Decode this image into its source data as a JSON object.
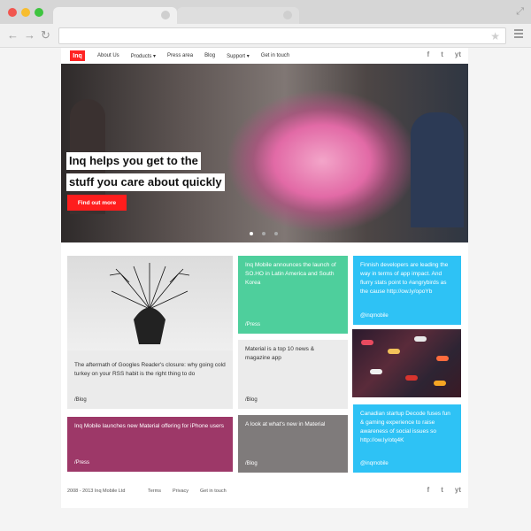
{
  "browser": {
    "address": "",
    "icons": [
      "back-arrow-icon",
      "forward-arrow-icon",
      "reload-icon",
      "star-icon",
      "menu-icon"
    ]
  },
  "nav": {
    "logo": "Inq",
    "links": [
      "About Us",
      "Products ▾",
      "Press area",
      "Blog",
      "Support ▾",
      "Get in touch"
    ],
    "social": [
      "f",
      "t",
      "yt"
    ]
  },
  "hero": {
    "line1": "Inq helps you get to the",
    "line2": "stuff you care about quickly",
    "cta": "Find out more"
  },
  "cards": {
    "tree": {
      "text": "The aftermath of Googles Reader's closure: why going cold turkey on your RSS habit is the right thing to do",
      "tag": "/Blog"
    },
    "green": {
      "text": "Inq Mobile announces the launch of SO.HO in Latin America and South Korea",
      "tag": "/Press"
    },
    "blue1": {
      "text": "Finnish developers are leading the way in terms of app impact. And flurry stats point to #angrybirds as the cause http://ow.ly/opoYb",
      "tag": "@inqmobile"
    },
    "material": {
      "text": "Material is a top 10 news & magazine app",
      "tag": "/Blog"
    },
    "plum": {
      "text": "Inq Mobile launches new Material offering for iPhone users",
      "tag": "/Press"
    },
    "dark": {
      "text": "A look at what's new in Material",
      "tag": "/Blog"
    },
    "blue2": {
      "text": "Canadian startup Decode fuses fun & gaming experience to raise awareness of social issues so http://ow.ly/otq4K",
      "tag": "@inqmobile"
    }
  },
  "footer": {
    "copy": "2008 - 2013 Inq Mobile Ltd",
    "links": [
      "Terms",
      "Privacy",
      "Get in touch"
    ]
  },
  "colors": {
    "brand": "#ff2323",
    "green": "#4ecf9c",
    "blue": "#2ec2f5",
    "plum": "#9d3868",
    "dark": "#7f7b7b"
  }
}
